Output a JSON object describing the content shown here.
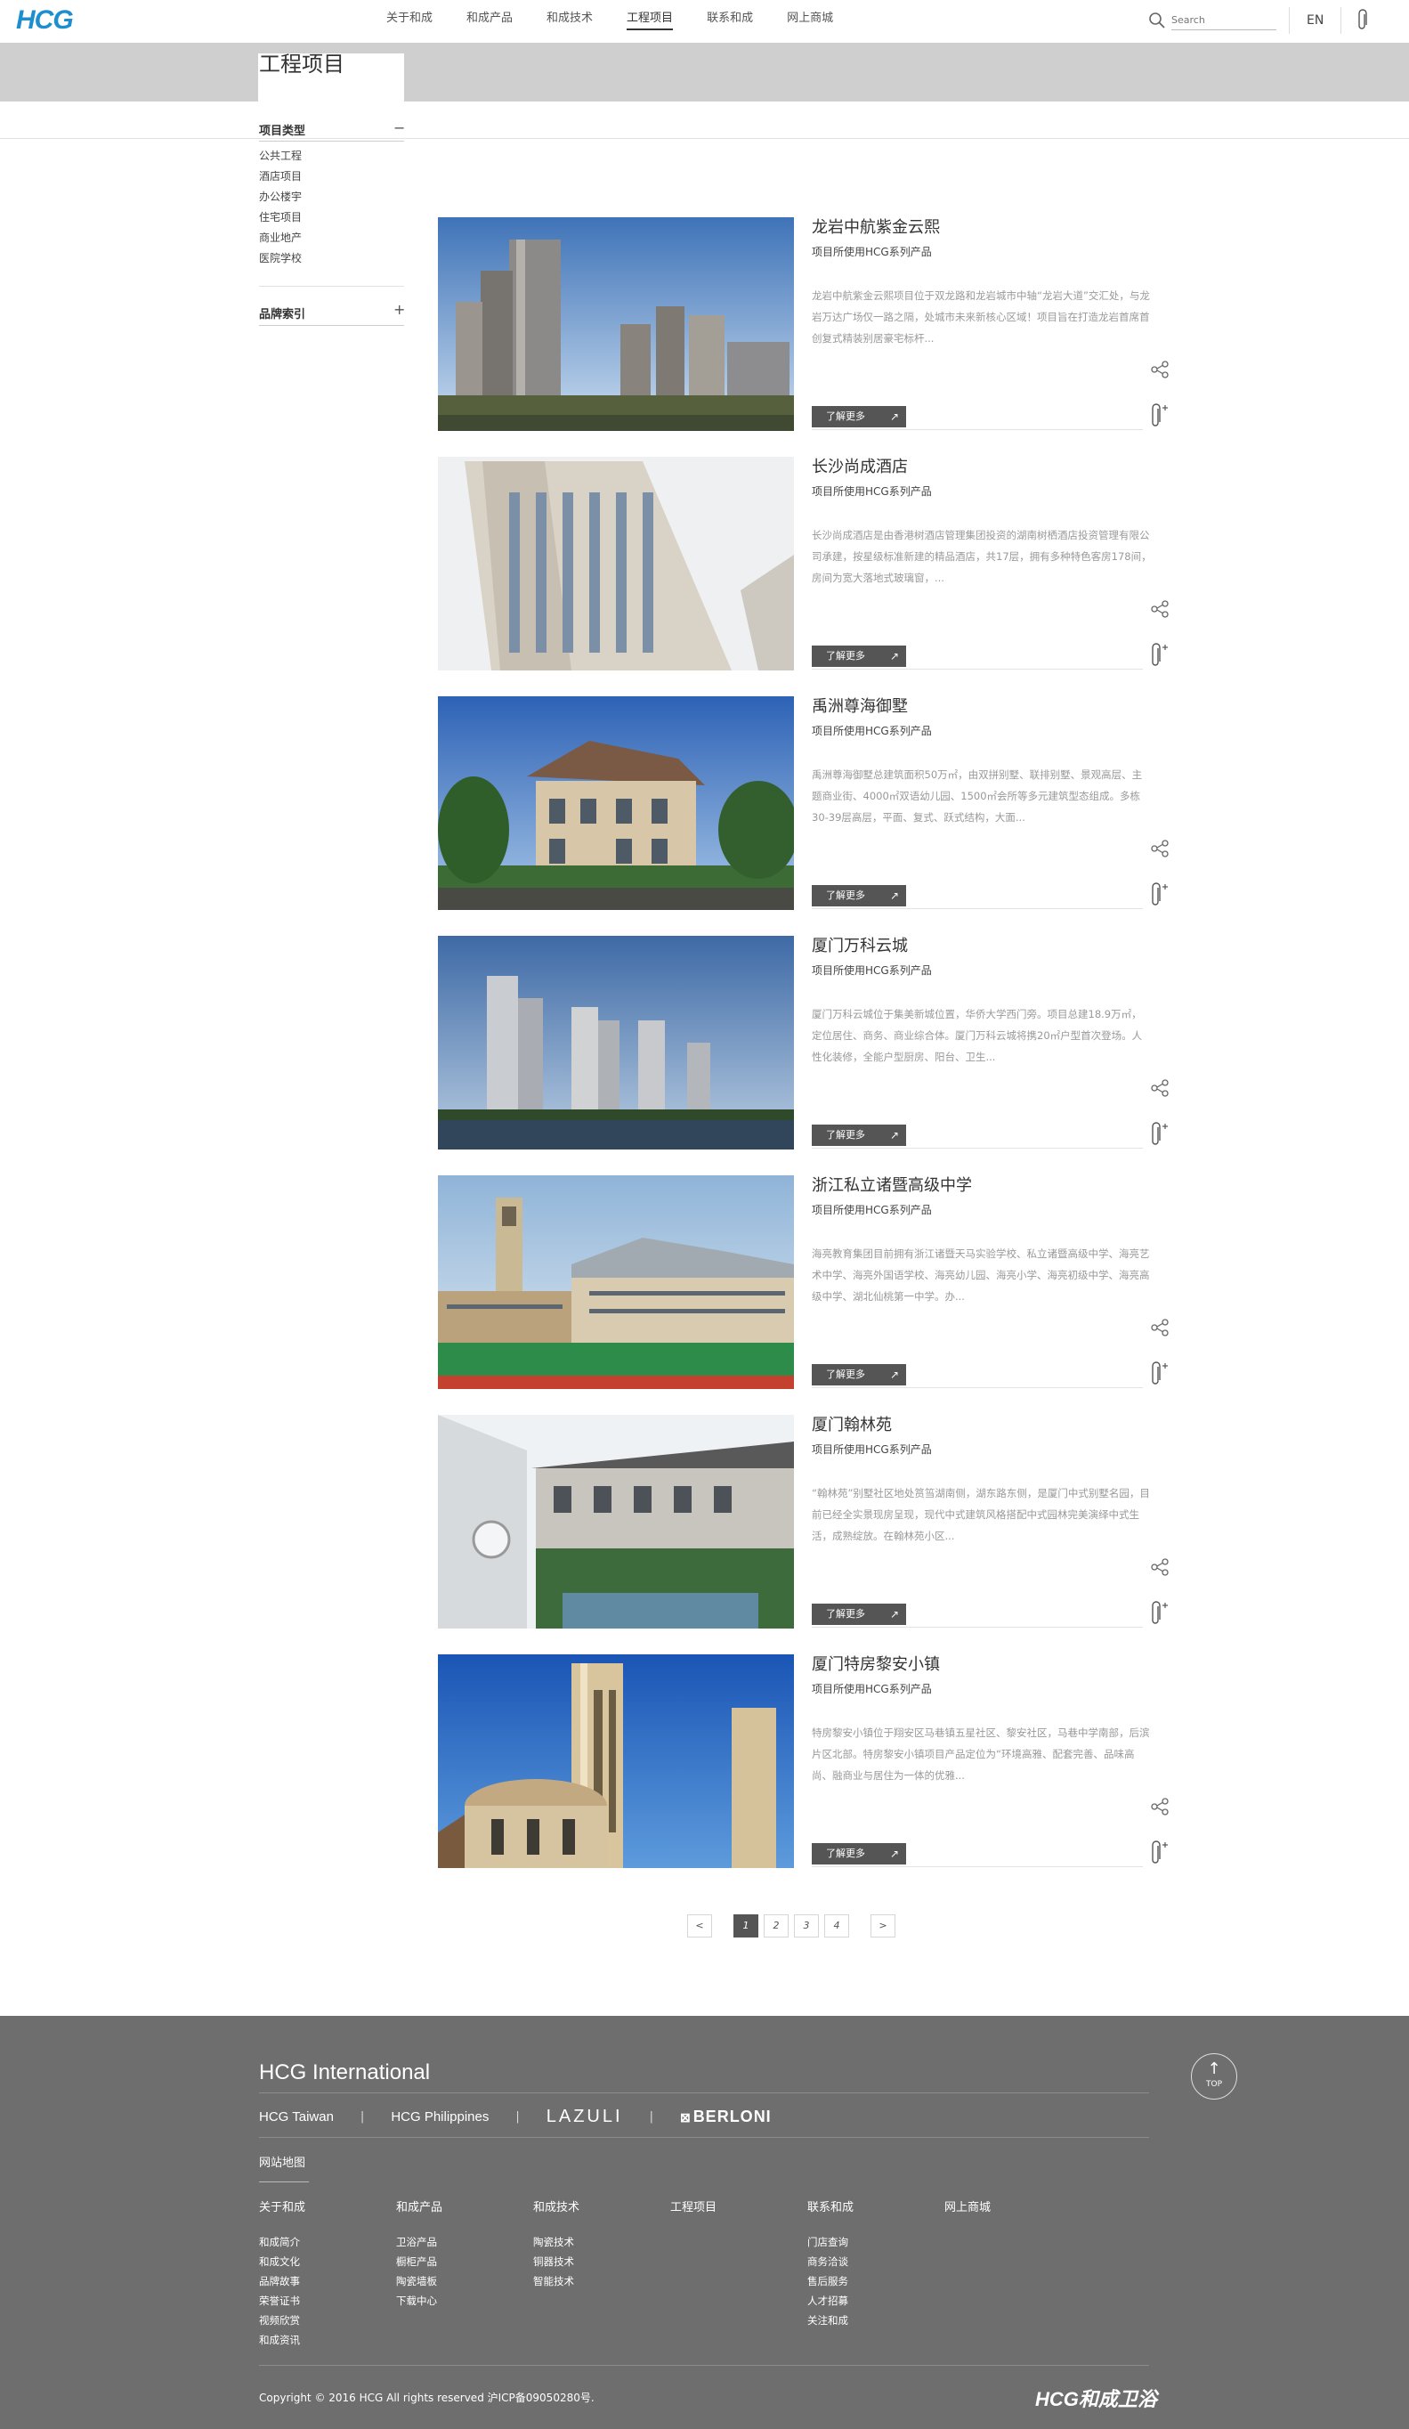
{
  "header": {
    "logo": "HCG",
    "nav": [
      "关于和成",
      "和成产品",
      "和成技术",
      "工程项目",
      "联系和成",
      "网上商城"
    ],
    "active_nav": "工程项目",
    "search_placeholder": "Search",
    "lang": "EN"
  },
  "page": {
    "title": "工程项目"
  },
  "sidebar": {
    "section1_title": "项目类型",
    "section1_toggle": "−",
    "items": [
      "公共工程",
      "酒店项目",
      "办公楼宇",
      "住宅项目",
      "商业地产",
      "医院学校"
    ],
    "section2_title": "品牌索引",
    "section2_toggle": "+"
  },
  "projects": [
    {
      "name": "龙岩中航紫金云熙",
      "subtitle": "项目所使用HCG系列产品",
      "desc": "龙岩中航紫金云熙项目位于双龙路和龙岩城市中轴“龙岩大道”交汇处，与龙岩万达广场仅一路之隔，处城市未来新核心区域！项目旨在打造龙岩首席首创复式精装别居豪宅标杆...",
      "more": "了解更多"
    },
    {
      "name": "长沙尚成酒店",
      "subtitle": "项目所使用HCG系列产品",
      "desc": "长沙尚成酒店是由香港树酒店管理集团投资的湖南树栖酒店投资管理有限公司承建，按星级标准新建的精品酒店，共17层，拥有多种特色客房178间，房间为宽大落地式玻璃窗，...",
      "more": "了解更多"
    },
    {
      "name": "禹洲尊海御墅",
      "subtitle": "项目所使用HCG系列产品",
      "desc": "禹洲尊海御墅总建筑面积50万㎡，由双拼别墅、联排别墅、景观高层、主题商业街、4000㎡双语幼儿园、1500㎡会所等多元建筑型态组成。多栋30-39层高层，平面、复式、跃式结构，大面...",
      "more": "了解更多"
    },
    {
      "name": "厦门万科云城",
      "subtitle": "项目所使用HCG系列产品",
      "desc": "厦门万科云城位于集美新城位置，华侨大学西门旁。项目总建18.9万㎡，定位居住、商务、商业综合体。厦门万科云城将携20㎡户型首次登场。人性化装修，全能户型厨房、阳台、卫生...",
      "more": "了解更多"
    },
    {
      "name": "浙江私立诸暨高级中学",
      "subtitle": "项目所使用HCG系列产品",
      "desc": "海亮教育集团目前拥有浙江诸暨天马实验学校、私立诸暨高级中学、海亮艺术中学、海亮外国语学校、海亮幼儿园、海亮小学、海亮初级中学、海亮高级中学、湖北仙桃第一中学。办...",
      "more": "了解更多"
    },
    {
      "name": "厦门翰林苑",
      "subtitle": "项目所使用HCG系列产品",
      "desc": "“翰林苑”别墅社区地处筼筜湖南侧，湖东路东侧，是厦门中式别墅名园，目前已经全实景现房呈现，现代中式建筑风格搭配中式园林完美演绎中式生活，成熟绽放。在翰林苑小区...",
      "more": "了解更多"
    },
    {
      "name": "厦门特房黎安小镇",
      "subtitle": "项目所使用HCG系列产品",
      "desc": "特房黎安小镇位于翔安区马巷镇五星社区、黎安社区，马巷中学南部，后滨片区北部。特房黎安小镇项目产品定位为“环境高雅、配套完善、品味高尚、融商业与居住为一体的优雅...",
      "more": "了解更多"
    }
  ],
  "pager": {
    "prev": "<",
    "pages": [
      "1",
      "2",
      "3",
      "4"
    ],
    "current": "1",
    "next": ">"
  },
  "footer": {
    "title": "HCG International",
    "top_label": "TOP",
    "top_arrow": "↑",
    "brands": [
      "HCG Taiwan",
      "HCG Philippines",
      "LAZULI",
      "BERLONI"
    ],
    "brand_sep": "|",
    "sitemap": "网站地图",
    "columns": [
      {
        "title": "关于和成",
        "items": [
          "和成简介",
          "和成文化",
          "品牌故事",
          "荣誉证书",
          "视频欣赏",
          "和成资讯"
        ]
      },
      {
        "title": "和成产品",
        "items": [
          "卫浴产品",
          "橱柜产品",
          "陶瓷墙板",
          "下载中心"
        ]
      },
      {
        "title": "和成技术",
        "items": [
          "陶瓷技术",
          "铜器技术",
          "智能技术"
        ]
      },
      {
        "title": "工程项目",
        "items": []
      },
      {
        "title": "联系和成",
        "items": [
          "门店查询",
          "商务洽谈",
          "售后服务",
          "人才招募",
          "关注和成"
        ]
      },
      {
        "title": "网上商城",
        "items": []
      }
    ],
    "copyright": "Copyright © 2016 HCG All rights reserved 沪ICP备09050280号.",
    "logo": "HCG和成卫浴"
  }
}
